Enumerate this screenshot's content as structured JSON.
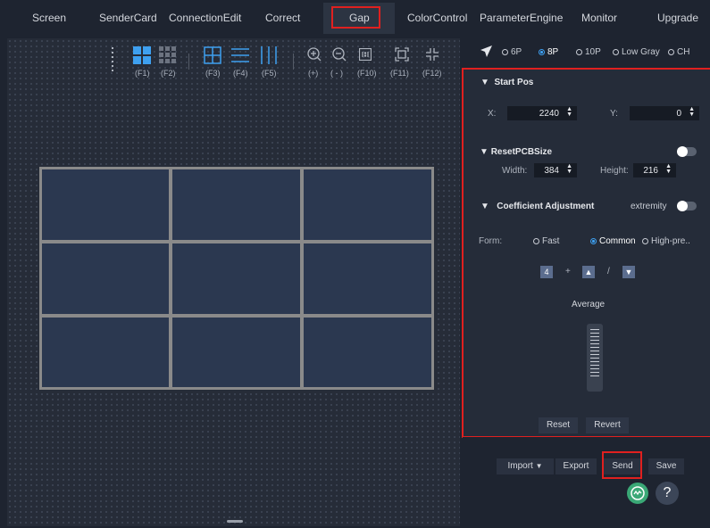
{
  "nav": {
    "tabs": [
      "Screen",
      "SenderCard",
      "ConnectionEdit",
      "Correct",
      "Gap",
      "ColorControl",
      "ParameterEngine",
      "Monitor",
      "Upgrade"
    ],
    "active": "Gap"
  },
  "toolbar": {
    "labels": [
      "(F1)",
      "(F2)",
      "(F3)",
      "(F4)",
      "(F5)",
      "(+)",
      "( - )",
      "(F10)",
      "(F11)",
      "(F12)"
    ]
  },
  "modes": {
    "options": [
      "6P",
      "8P",
      "10P",
      "Low Gray",
      "CH"
    ],
    "selected": "8P"
  },
  "start_pos": {
    "title": "Start Pos",
    "x_label": "X:",
    "x_value": "2240",
    "y_label": "Y:",
    "y_value": "0"
  },
  "reset_pcb": {
    "title": "ResetPCBSize",
    "width_label": "Width:",
    "width_value": "384",
    "height_label": "Height:",
    "height_value": "216"
  },
  "coeff": {
    "title": "Coefficient Adjustment",
    "extremity_label": "extremity",
    "form_label": "Form:",
    "forms": [
      "Fast",
      "Common",
      "High-pre.."
    ],
    "form_selected": "Common",
    "step_value": "4",
    "plus": "+",
    "slash": "/",
    "average_label": "Average",
    "reset_label": "Reset",
    "revert_label": "Revert"
  },
  "footer": {
    "import_label": "Import",
    "export_label": "Export",
    "send_label": "Send",
    "save_label": "Save",
    "help_label": "?"
  },
  "colors": {
    "accent": "#3ea0f0",
    "highlight": "#e0201f",
    "cell": "#2b3850",
    "online": "#3aa876"
  }
}
